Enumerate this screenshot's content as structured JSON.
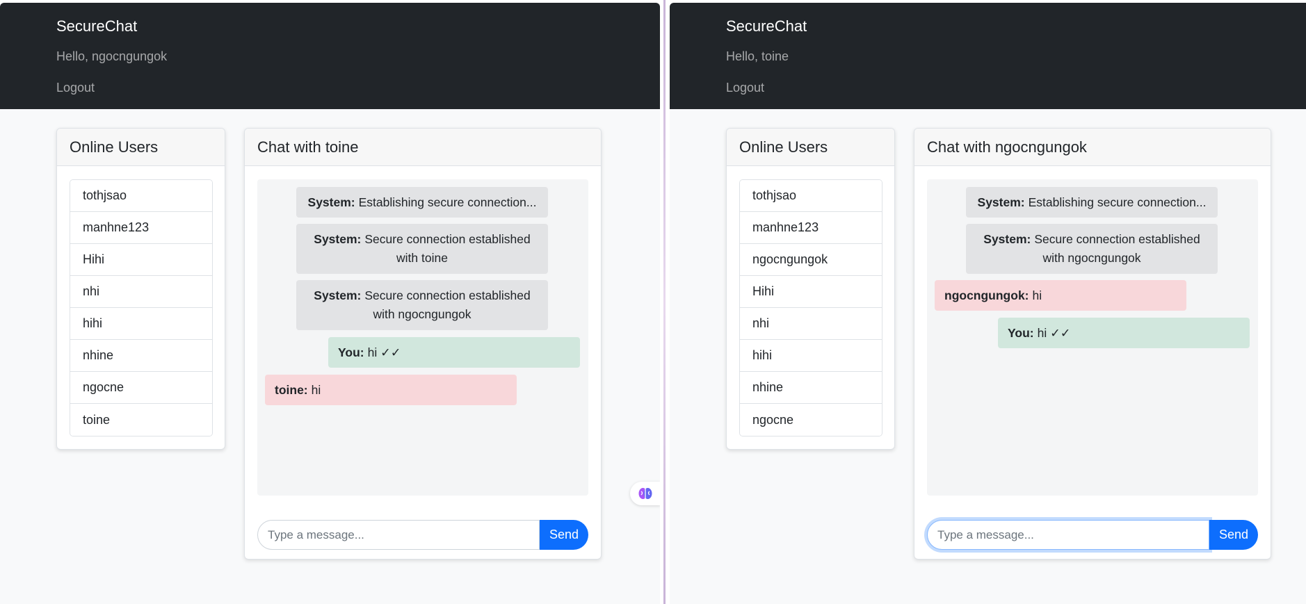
{
  "left": {
    "navbar": {
      "brand": "SecureChat",
      "greeting": "Hello, ngocngungok",
      "logout": "Logout"
    },
    "users": {
      "title": "Online Users",
      "items": [
        "tothjsao",
        "manhne123",
        "Hihi",
        "nhi",
        "hihi",
        "nhine",
        "ngocne",
        "toine"
      ]
    },
    "chat": {
      "title": "Chat with toine",
      "messages": [
        {
          "type": "system",
          "sender": "System:",
          "text": "Establishing secure connection..."
        },
        {
          "type": "system",
          "sender": "System:",
          "text": "Secure connection established with toine"
        },
        {
          "type": "system",
          "sender": "System:",
          "text": "Secure connection established with ngocngungok"
        },
        {
          "type": "sent",
          "sender": "You:",
          "text": "hi ✓✓"
        },
        {
          "type": "recv",
          "sender": "toine:",
          "text": "hi"
        }
      ],
      "input_placeholder": "Type a message...",
      "send_label": "Send"
    }
  },
  "right": {
    "navbar": {
      "brand": "SecureChat",
      "greeting": "Hello, toine",
      "logout": "Logout"
    },
    "users": {
      "title": "Online Users",
      "items": [
        "tothjsao",
        "manhne123",
        "ngocngungok",
        "Hihi",
        "nhi",
        "hihi",
        "nhine",
        "ngocne"
      ]
    },
    "chat": {
      "title": "Chat with ngocngungok",
      "messages": [
        {
          "type": "system",
          "sender": "System:",
          "text": "Establishing secure connection..."
        },
        {
          "type": "system",
          "sender": "System:",
          "text": "Secure connection established with ngocngungok"
        },
        {
          "type": "recv",
          "sender": "ngocngungok:",
          "text": "hi"
        },
        {
          "type": "sent",
          "sender": "You:",
          "text": "hi ✓✓"
        }
      ],
      "input_placeholder": "Type a message...",
      "send_label": "Send"
    }
  },
  "extension_icon": "brain-icon",
  "colors": {
    "navbar": "#212529",
    "system_bubble": "#e2e3e5",
    "sent_bubble": "#d1e7dd",
    "received_bubble": "#f8d7da",
    "send_button": "#0d6efd"
  }
}
